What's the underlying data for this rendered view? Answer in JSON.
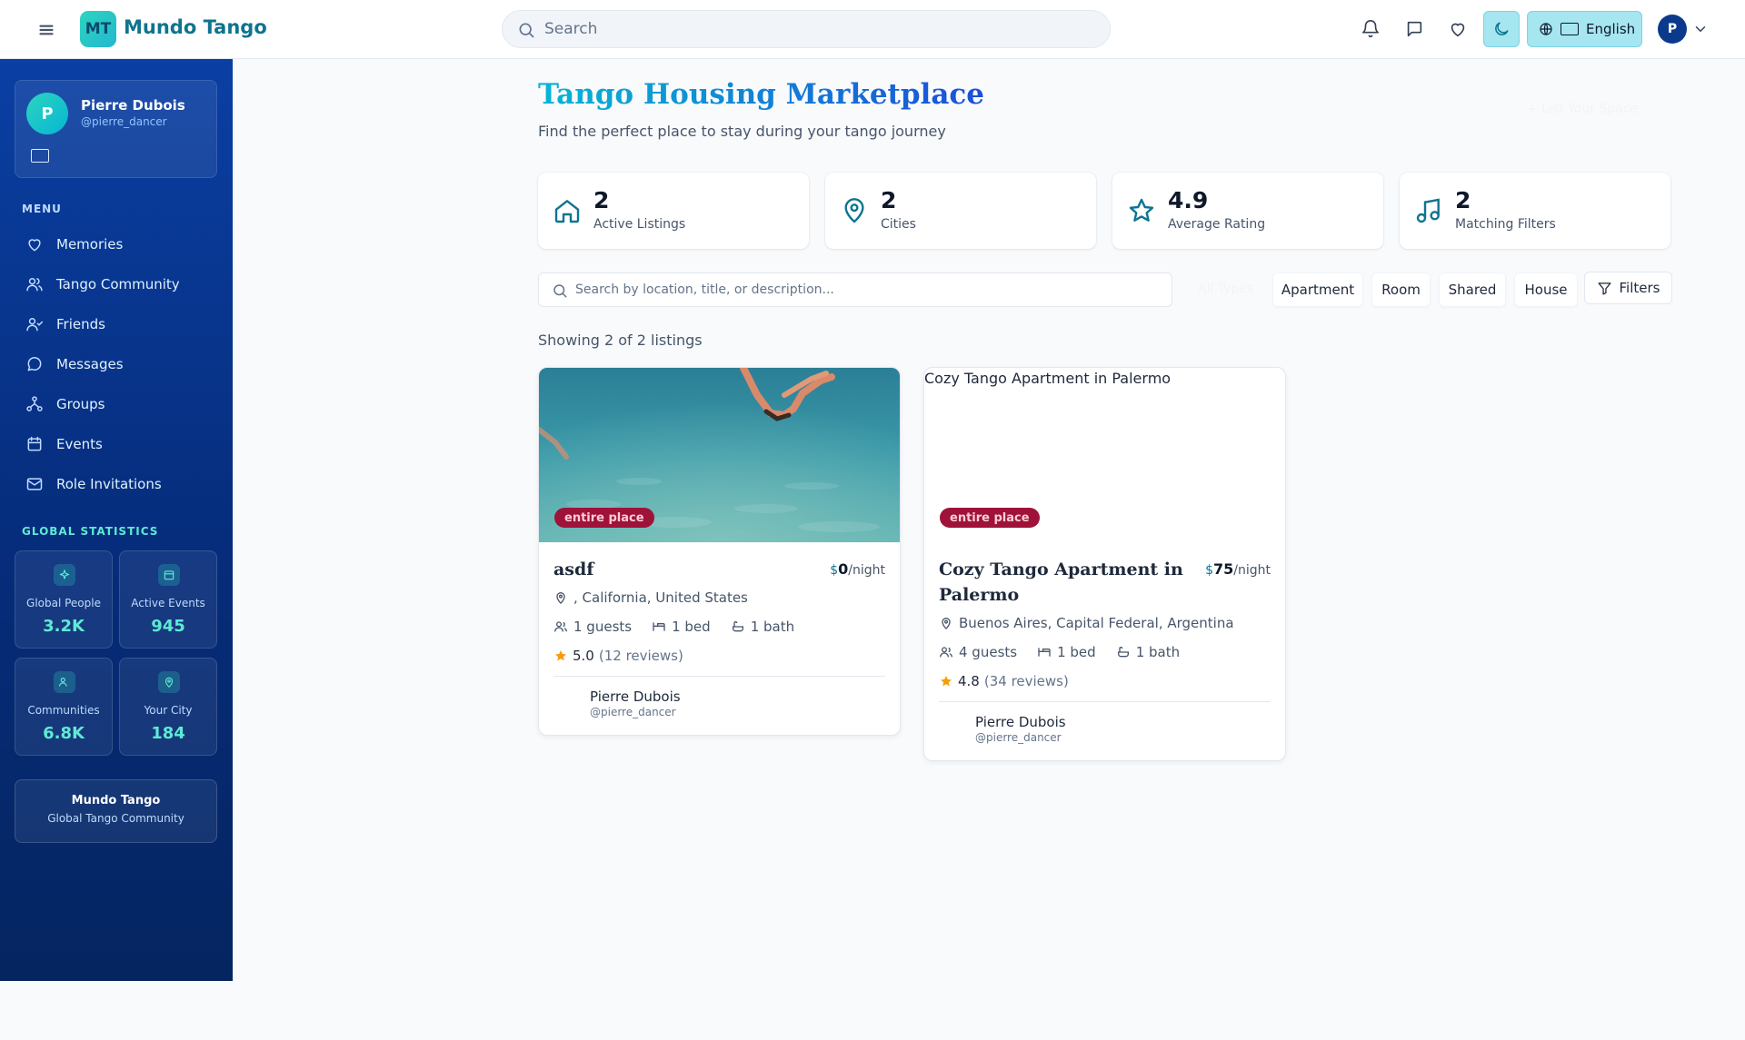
{
  "header": {
    "brand_initials": "MT",
    "brand_name": "Mundo Tango",
    "search_placeholder": "Search",
    "language": "English",
    "avatar_initial": "P"
  },
  "sidebar": {
    "profile": {
      "initial": "P",
      "name": "Pierre Dubois",
      "handle": "@pierre_dancer"
    },
    "menu_label": "MENU",
    "menu_items": [
      {
        "label": "Memories",
        "icon": "heart-icon"
      },
      {
        "label": "Tango Community",
        "icon": "users-icon"
      },
      {
        "label": "Friends",
        "icon": "user-check-icon"
      },
      {
        "label": "Messages",
        "icon": "message-circle-icon"
      },
      {
        "label": "Groups",
        "icon": "network-icon"
      },
      {
        "label": "Events",
        "icon": "calendar-icon"
      },
      {
        "label": "Role Invitations",
        "icon": "mail-icon"
      }
    ],
    "stats_label": "GLOBAL STATISTICS",
    "stats": [
      {
        "label": "Global People",
        "value": "3.2K",
        "icon": "sparkles-icon"
      },
      {
        "label": "Active Events",
        "value": "945",
        "icon": "calendar-icon"
      },
      {
        "label": "Communities",
        "value": "6.8K",
        "icon": "users-icon"
      },
      {
        "label": "Your City",
        "value": "184",
        "icon": "map-pin-icon"
      }
    ],
    "footer": {
      "title": "Mundo Tango",
      "subtitle": "Global Tango Community"
    }
  },
  "main": {
    "title": "Tango Housing Marketplace",
    "subtitle": "Find the perfect place to stay during your tango journey",
    "list_button": "+ List Your Space",
    "kpis": [
      {
        "value": "2",
        "label": "Active Listings",
        "icon": "home-icon"
      },
      {
        "value": "2",
        "label": "Cities",
        "icon": "map-pin-icon"
      },
      {
        "value": "4.9",
        "label": "Average Rating",
        "icon": "star-icon"
      },
      {
        "value": "2",
        "label": "Matching Filters",
        "icon": "music-icon"
      }
    ],
    "search_placeholder": "Search by location, title, or description...",
    "type_filters": [
      "All Types",
      "Apartment",
      "Room",
      "Shared",
      "House"
    ],
    "filters_label": "Filters",
    "showing": "Showing 2 of 2 listings",
    "listings": [
      {
        "title": "asdf",
        "image_alt": "",
        "badge": "entire place",
        "currency": "$",
        "price": "0",
        "per": "/night",
        "location": ", California, United States",
        "guests": "1 guests",
        "beds": "1 bed",
        "baths": "1 bath",
        "rating": "5.0",
        "reviews": "(12 reviews)",
        "host_name": "Pierre Dubois",
        "host_handle": "@pierre_dancer"
      },
      {
        "title": "Cozy Tango Apartment in Palermo",
        "image_alt": "Cozy Tango Apartment in Palermo",
        "badge": "entire place",
        "currency": "$",
        "price": "75",
        "per": "/night",
        "location": "Buenos Aires, Capital Federal, Argentina",
        "guests": "4 guests",
        "beds": "1 bed",
        "baths": "1 bath",
        "rating": "4.8",
        "reviews": "(34 reviews)",
        "host_name": "Pierre Dubois",
        "host_handle": "@pierre_dancer"
      }
    ]
  }
}
